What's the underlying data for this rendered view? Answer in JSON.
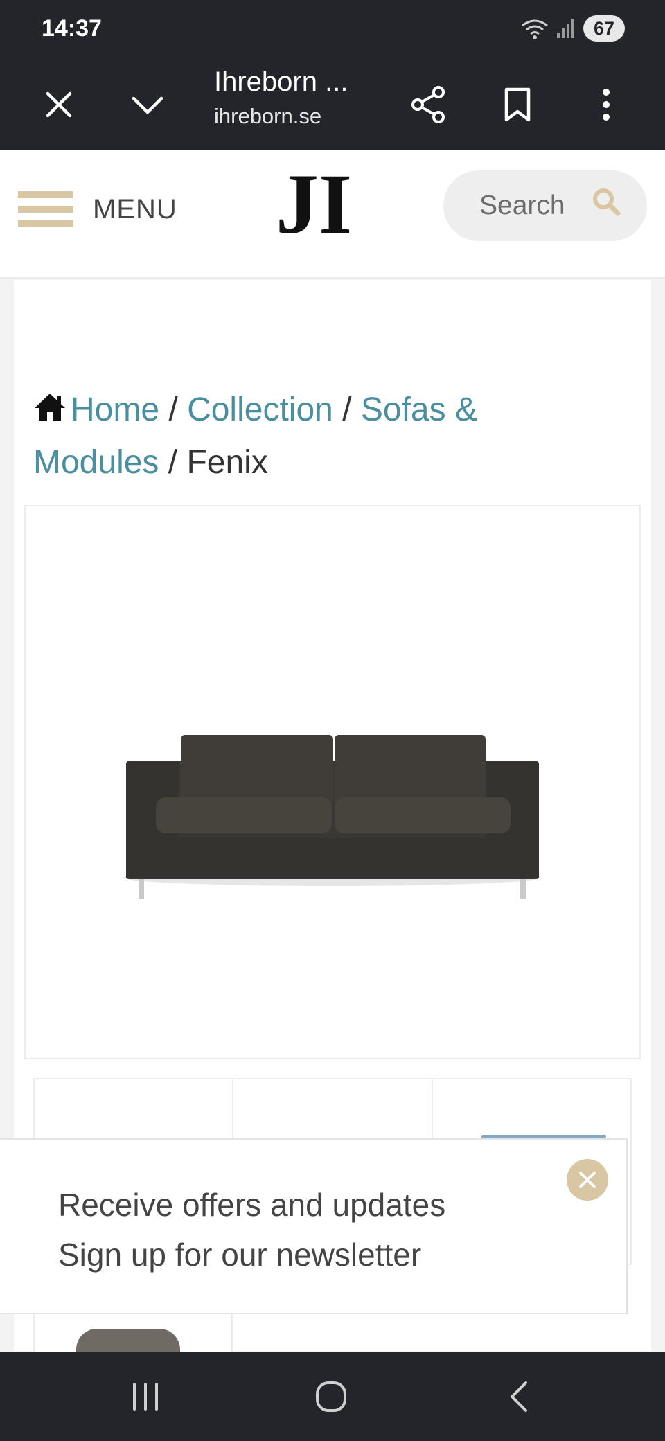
{
  "status_bar": {
    "time": "14:37",
    "battery": "67"
  },
  "browser": {
    "title": "Ihreborn ...",
    "url": "ihreborn.se"
  },
  "header": {
    "menu_label": "MENU",
    "logo_text": "JI",
    "search_placeholder": "Search"
  },
  "breadcrumb": {
    "home": "Home",
    "sep1": " / ",
    "collection": "Collection",
    "sep2": " / ",
    "category": "Sofas & Modules",
    "sep3": " / ",
    "current": "Fenix"
  },
  "newsletter": {
    "line1": "Receive offers and updates",
    "line2": "Sign up for our newsletter"
  },
  "colors": {
    "accent": "#d9c6a3",
    "link": "#4a8fa0",
    "dark": "#23252b"
  }
}
